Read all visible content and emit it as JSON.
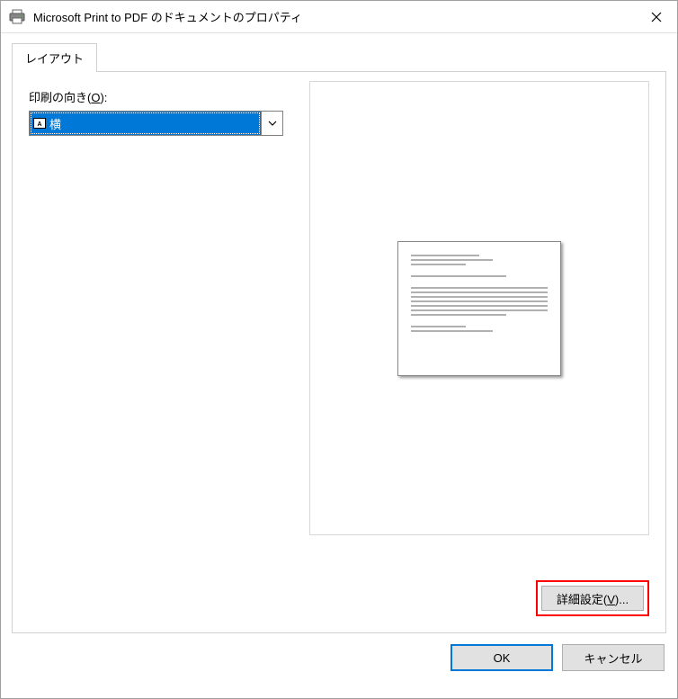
{
  "title": "Microsoft Print to PDF のドキュメントのプロパティ",
  "tabs": [
    {
      "label": "レイアウト"
    }
  ],
  "orientation": {
    "label_prefix": "印刷の向き(",
    "label_key": "O",
    "label_suffix": "):",
    "selected": "横"
  },
  "buttons": {
    "advanced_prefix": "詳細設定(",
    "advanced_key": "V",
    "advanced_suffix": ")...",
    "ok": "OK",
    "cancel": "キャンセル"
  },
  "colors": {
    "selection": "#0078d7",
    "highlight_border": "#ff0000"
  }
}
